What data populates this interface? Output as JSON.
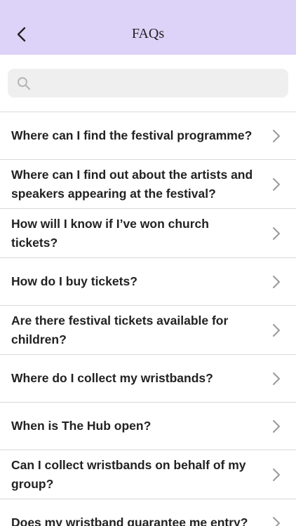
{
  "header": {
    "title": "FAQs",
    "background": "#ddd2f7"
  },
  "search": {
    "placeholder": "",
    "value": ""
  },
  "faqs": [
    {
      "question": "Where can I find the festival programme?"
    },
    {
      "question": "Where can I find out about the artists and speakers appearing at the festival?"
    },
    {
      "question": "How will I know if I’ve won church tickets?"
    },
    {
      "question": "How do I buy tickets?"
    },
    {
      "question": "Are there festival tickets available for children?"
    },
    {
      "question": "Where do I collect my wristbands?"
    },
    {
      "question": "When is The Hub open?"
    },
    {
      "question": "Can I collect wristbands on behalf of my group?"
    },
    {
      "question": "Does my wristband guarantee me entry?"
    }
  ]
}
